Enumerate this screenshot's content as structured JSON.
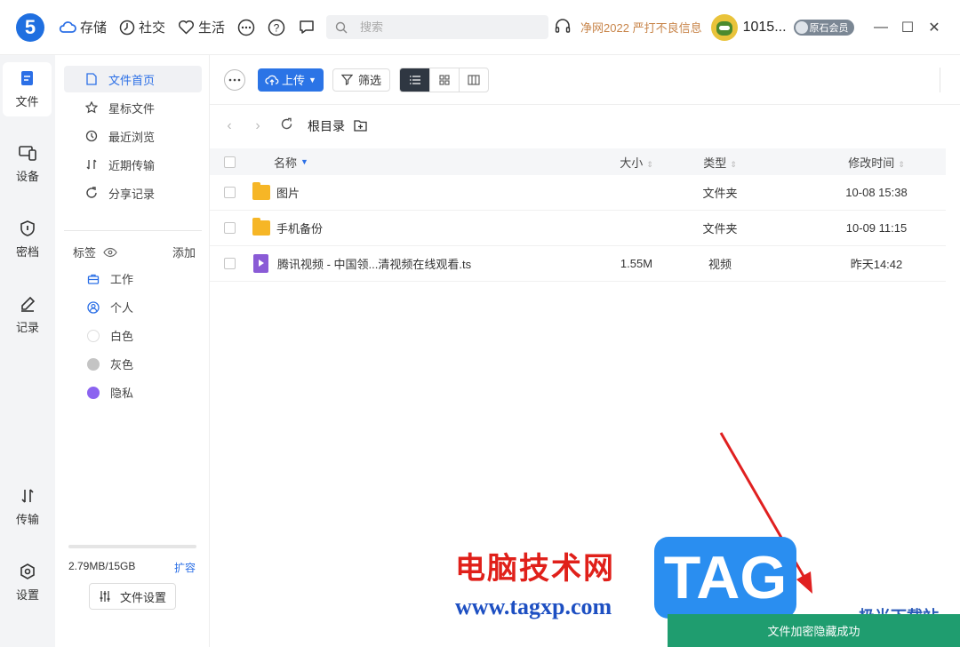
{
  "app": {
    "logo_text": "5"
  },
  "topnav": [
    {
      "label": "存储",
      "icon": "cloud-icon"
    },
    {
      "label": "社交",
      "icon": "compass-icon"
    },
    {
      "label": "生活",
      "icon": "heart-icon"
    }
  ],
  "search": {
    "placeholder": "搜索"
  },
  "promo_text": "净网2022 严打不良信息",
  "user": {
    "name": "1015...",
    "badge": "原石会员"
  },
  "rail": [
    {
      "label": "文件",
      "icon": "file-icon",
      "active": true
    },
    {
      "label": "设备",
      "icon": "devices-icon"
    },
    {
      "label": "密档",
      "icon": "shield-icon"
    },
    {
      "label": "记录",
      "icon": "pen-icon"
    },
    {
      "label": "传输",
      "icon": "transfer-icon"
    },
    {
      "label": "设置",
      "icon": "settings-icon"
    }
  ],
  "sidebar": {
    "items": [
      {
        "label": "文件首页",
        "icon": "document-icon",
        "active": true
      },
      {
        "label": "星标文件",
        "icon": "star-icon"
      },
      {
        "label": "最近浏览",
        "icon": "history-icon"
      },
      {
        "label": "近期传输",
        "icon": "transfer-icon"
      },
      {
        "label": "分享记录",
        "icon": "share-icon"
      }
    ],
    "tags_title": "标签",
    "tags_add": "添加",
    "tags": [
      {
        "label": "工作",
        "icon": "briefcase-icon"
      },
      {
        "label": "个人",
        "icon": "person-icon"
      },
      {
        "label": "白色",
        "color": "#ffffff"
      },
      {
        "label": "灰色",
        "color": "#c4c4c4"
      },
      {
        "label": "隐私",
        "color": "#8b63f0"
      }
    ],
    "storage_text": "2.79MB/15GB",
    "storage_used_fraction": 0.0002,
    "expand_label": "扩容",
    "file_settings_label": "文件设置"
  },
  "toolbar": {
    "upload_label": "上传",
    "filter_label": "筛选"
  },
  "breadcrumb": {
    "title": "根目录"
  },
  "table": {
    "headers": {
      "name": "名称",
      "size": "大小",
      "type": "类型",
      "time": "修改时间"
    },
    "rows": [
      {
        "name": "图片",
        "size": "",
        "type": "文件夹",
        "time": "10-08 15:38",
        "kind": "folder"
      },
      {
        "name": "手机备份",
        "size": "",
        "type": "文件夹",
        "time": "10-09 11:15",
        "kind": "folder"
      },
      {
        "name": "腾讯视频 - 中国领...清视频在线观看.ts",
        "size": "1.55M",
        "type": "视频",
        "time": "昨天14:42",
        "kind": "video"
      }
    ]
  },
  "watermark": {
    "cn": "电脑技术网",
    "url": "www.tagxp.com",
    "tag": "TAG",
    "site": "极光下载站"
  },
  "toast": {
    "message": "文件加密隐藏成功"
  },
  "colors": {
    "accent": "#2b74e6",
    "toast": "#1f9d6f",
    "promo": "#c8854a"
  }
}
